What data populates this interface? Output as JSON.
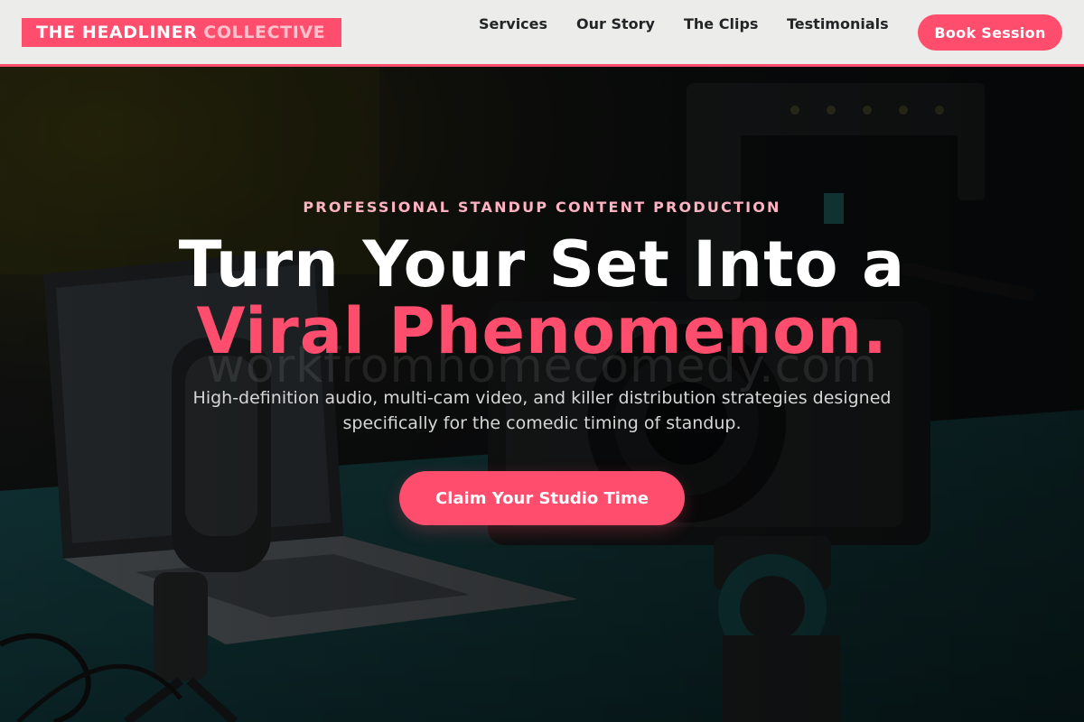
{
  "header": {
    "logo_primary": "THE HEADLINER",
    "logo_secondary": "COLLECTIVE",
    "nav": {
      "services": "Services",
      "our_story": "Our Story",
      "clips": "The Clips",
      "testimonials": "Testimonials"
    },
    "book_button": "Book Session"
  },
  "hero": {
    "eyebrow": "PROFESSIONAL STANDUP CONTENT PRODUCTION",
    "headline_line1": "Turn Your Set Into a",
    "headline_line2": "Viral Phenomenon.",
    "watermark": "workfromhomecomedy.com",
    "subheadline": "High-definition audio, multi-cam video, and killer distribution strategies designed specifically for the comedic timing of standup.",
    "cta": "Claim Your Studio Time",
    "background": "camera-studio-photo"
  },
  "colors": {
    "accent": "#ff4d6d",
    "accent_light": "#ffb3c2",
    "header_bg": "#ececeb",
    "nav_text": "#222426",
    "hero_text": "#ffffff",
    "subhead_text": "#d6d6d6"
  }
}
